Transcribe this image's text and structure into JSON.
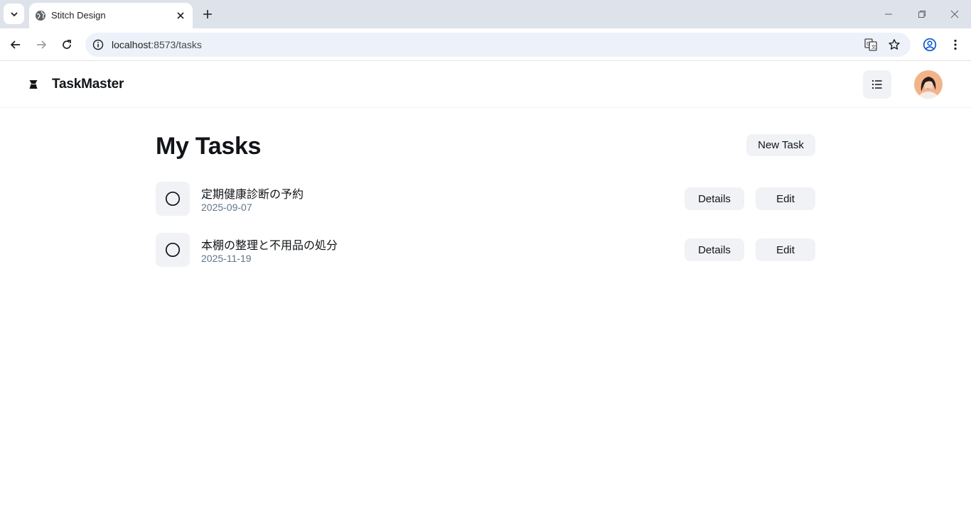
{
  "browser": {
    "tab_title": "Stitch Design",
    "url_host": "localhost",
    "url_path": ":8573/tasks"
  },
  "app": {
    "brand": "TaskMaster",
    "page_title": "My Tasks",
    "new_task_label": "New Task",
    "details_label": "Details",
    "edit_label": "Edit"
  },
  "tasks": [
    {
      "title": "定期健康診断の予約",
      "date": "2025-09-07",
      "completed": false
    },
    {
      "title": "本棚の整理と不用品の処分",
      "date": "2025-11-19",
      "completed": false
    }
  ],
  "colors": {
    "secondary_bg": "#f0f2f5",
    "muted_text": "#60758a",
    "text": "#111418"
  }
}
